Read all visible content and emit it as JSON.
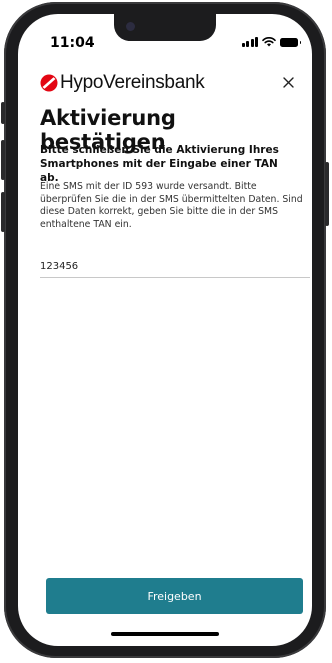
{
  "status_bar": {
    "time": "11:04"
  },
  "header": {
    "brand_name": "HypoVereinsbank",
    "brand_color": "#e30613",
    "close_icon": "close-icon"
  },
  "page": {
    "title": "Aktivierung bestätigen",
    "subtitle": "Bitte schließen Sie die Aktivierung Ihres Smartphones mit der Eingabe einer TAN ab.",
    "info": "Eine SMS mit der ID 593 wurde versandt. Bitte überprüfen Sie die in der SMS übermittelten Daten. Sind diese Daten korrekt, geben Sie bitte die in der SMS enthaltene TAN ein."
  },
  "tan_input": {
    "value": "123456",
    "placeholder": ""
  },
  "actions": {
    "release_label": "Freigeben",
    "button_color": "#1f7d8e"
  }
}
